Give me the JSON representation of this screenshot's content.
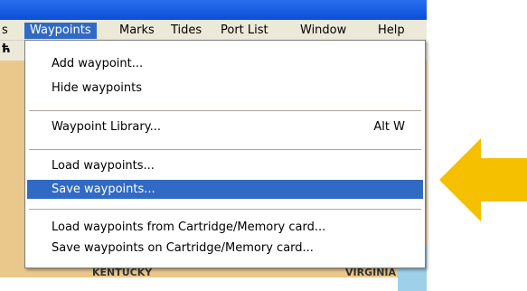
{
  "menubar": {
    "items": [
      {
        "label": "s"
      },
      {
        "label": "Waypoints"
      },
      {
        "label": "Marks"
      },
      {
        "label": "Tides"
      },
      {
        "label": "Port List"
      },
      {
        "label": "Window"
      },
      {
        "label": "Help"
      }
    ]
  },
  "waypoints_menu": {
    "items": [
      {
        "label": "Add waypoint..."
      },
      {
        "label": "Hide waypoints"
      },
      {
        "label": "Waypoint Library...",
        "shortcut": "Alt W"
      },
      {
        "label": "Load waypoints..."
      },
      {
        "label": "Save waypoints..."
      },
      {
        "label": "Load waypoints from Cartridge/Memory card..."
      },
      {
        "label": "Save waypoints on Cartridge/Memory card..."
      }
    ],
    "selected_index": 4
  },
  "map": {
    "label_left": "KENTUCKY",
    "label_right": "VIRGINIA"
  },
  "colors": {
    "menu_highlight": "#316ac5",
    "arrow": "#f5c000",
    "map_land": "#eac88b"
  },
  "icons": {
    "pointer": "arrow-pointer-icon"
  }
}
